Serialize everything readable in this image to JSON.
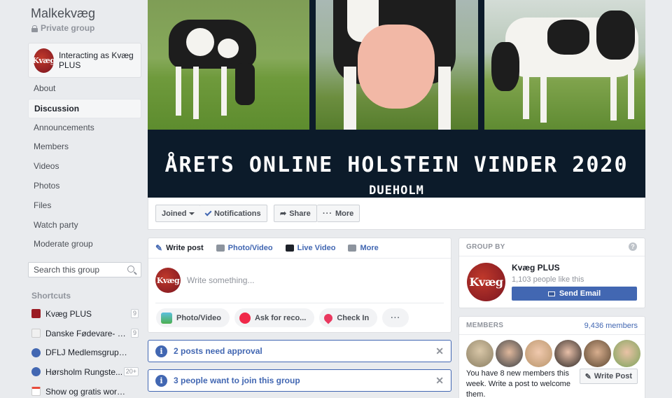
{
  "group": {
    "name": "Malkekvæg",
    "privacy": "Private group",
    "interacting_as": "Interacting as Kvæg PLUS",
    "logo_text": "Kvæg"
  },
  "nav": [
    {
      "label": "About",
      "active": false
    },
    {
      "label": "Discussion",
      "active": true
    },
    {
      "label": "Announcements",
      "active": false
    },
    {
      "label": "Members",
      "active": false
    },
    {
      "label": "Videos",
      "active": false
    },
    {
      "label": "Photos",
      "active": false
    },
    {
      "label": "Files",
      "active": false
    },
    {
      "label": "Watch party",
      "active": false
    },
    {
      "label": "Moderate group",
      "active": false
    }
  ],
  "search": {
    "placeholder": "Search this group",
    "icon": "search-icon"
  },
  "shortcuts": {
    "title": "Shortcuts",
    "items": [
      {
        "label": "Kvæg PLUS",
        "badge": "9",
        "icon": "kvaeg-logo-icon"
      },
      {
        "label": "Danske Fødevare- o...",
        "badge": "9",
        "icon": "page-icon"
      },
      {
        "label": "DFLJ Medlemsgruppen",
        "badge": "",
        "icon": "group-icon"
      },
      {
        "label": "Hørsholm Rungste...",
        "badge": "20+",
        "icon": "group-icon"
      },
      {
        "label": "Show og gratis worksho...",
        "badge": "",
        "icon": "calendar-icon"
      }
    ]
  },
  "cover": {
    "title": "ÅRETS ONLINE HOLSTEIN VINDER 2020",
    "subtitle": "DUEHOLM"
  },
  "actions": {
    "joined": "Joined",
    "notifications": "Notifications",
    "share": "Share",
    "more": "More"
  },
  "composer": {
    "tabs": [
      "Write post",
      "Photo/Video",
      "Live Video",
      "More"
    ],
    "placeholder": "Write something...",
    "buttons": [
      "Photo/Video",
      "Ask for reco...",
      "Check In"
    ],
    "more_dots": "···"
  },
  "notices": [
    {
      "text": "2 posts need approval"
    },
    {
      "text": "3 people want to join this group"
    }
  ],
  "group_by": {
    "header": "GROUP BY",
    "name": "Kvæg PLUS",
    "likes": "1,103 people like this",
    "send_email": "Send Email"
  },
  "members": {
    "header": "MEMBERS",
    "count": "9,436 members",
    "text": "You have 8 new members this week. Write a post to welcome them.",
    "write_post": "Write Post"
  },
  "colors": {
    "accent": "#4267b2",
    "background": "#e9ebee",
    "brand_red": "#9b1c24"
  }
}
